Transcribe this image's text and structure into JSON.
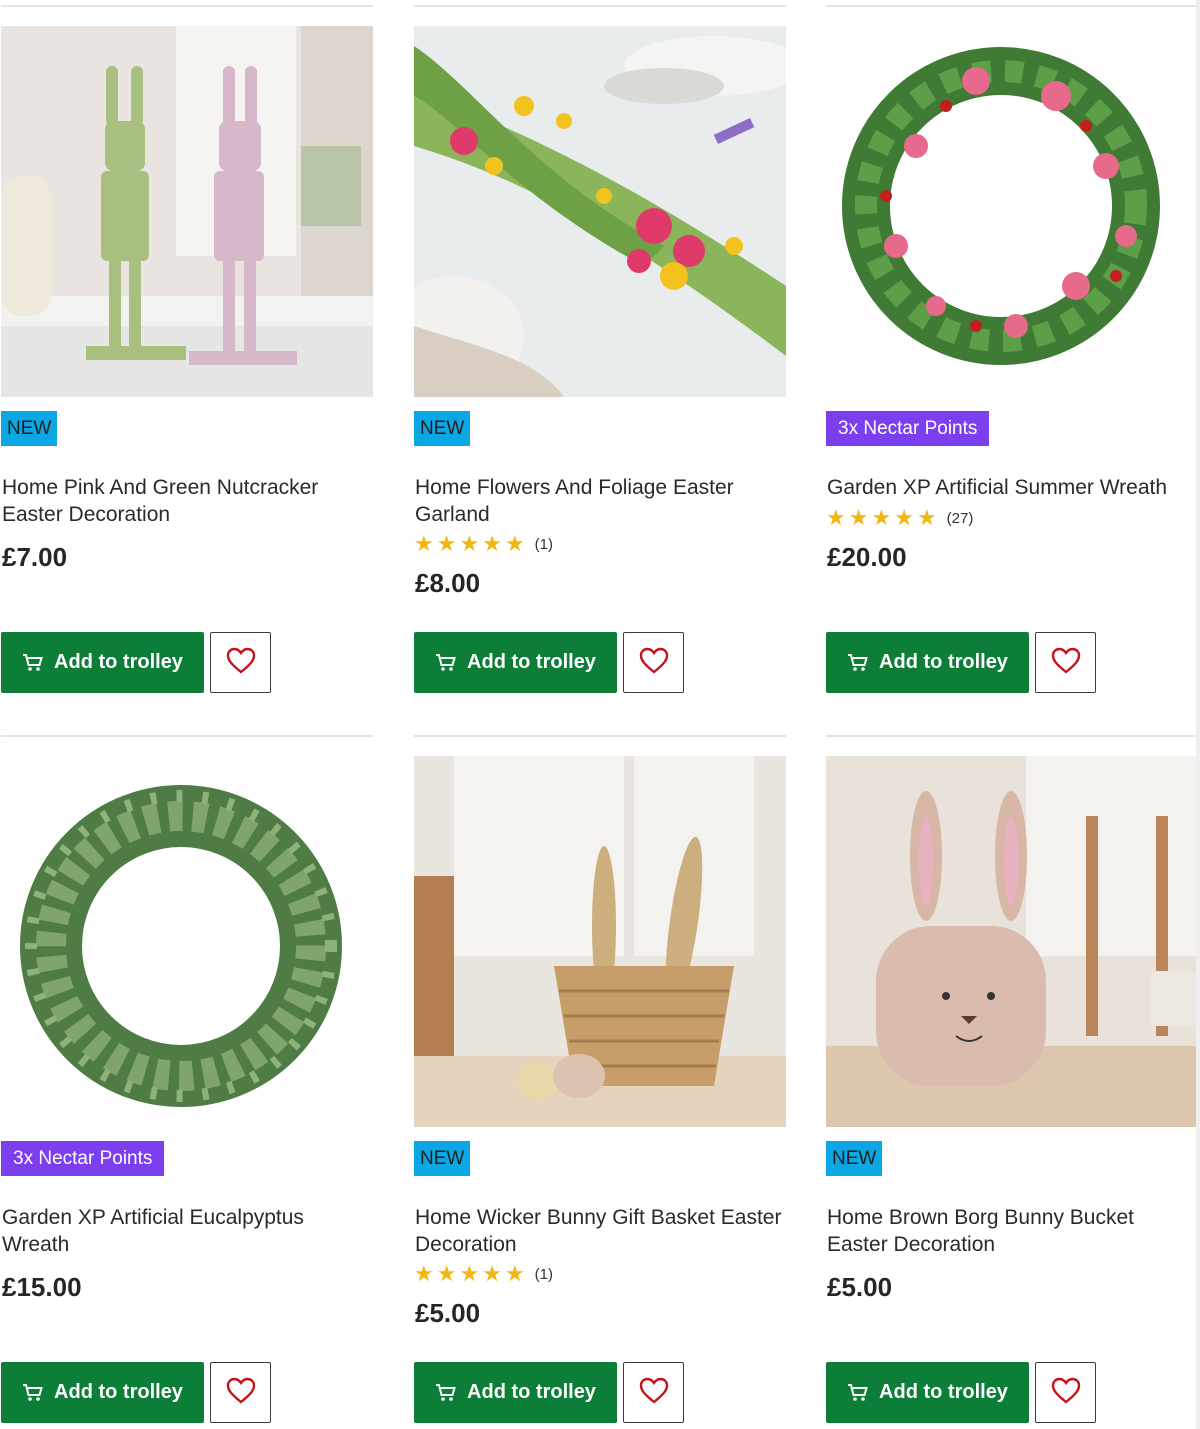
{
  "colors": {
    "brand_green": "#0c7e38",
    "new_badge": "#0aa7e4",
    "nectar_badge": "#7b3ff0",
    "star": "#f2b811",
    "heart": "#c4121a"
  },
  "actions": {
    "add_label": "Add to trolley",
    "cart_icon": "trolley-icon",
    "favourite_icon": "heart-icon"
  },
  "products": [
    {
      "badge": "NEW",
      "badge_type": "new",
      "title": "Home Pink And Green Nutcracker Easter Decoration",
      "price": "£7.00",
      "rating": null,
      "image": "nutcracker-figures"
    },
    {
      "badge": "NEW",
      "badge_type": "new",
      "title": "Home Flowers And Foliage Easter Garland",
      "price": "£8.00",
      "rating": {
        "stars": 5,
        "count": "(1)"
      },
      "image": "flower-garland"
    },
    {
      "badge": "3x Nectar Points",
      "badge_type": "nectar",
      "title": "Garden XP Artificial Summer Wreath",
      "price": "£20.00",
      "rating": {
        "stars": 5,
        "count": "(27)"
      },
      "image": "summer-wreath"
    },
    {
      "badge": "3x Nectar Points",
      "badge_type": "nectar",
      "title": "Garden XP Artificial Eucalpyptus Wreath",
      "price": "£15.00",
      "rating": null,
      "image": "eucalyptus-wreath"
    },
    {
      "badge": "NEW",
      "badge_type": "new",
      "title": "Home Wicker Bunny Gift Basket Easter Decoration",
      "price": "£5.00",
      "rating": {
        "stars": 5,
        "count": "(1)"
      },
      "image": "wicker-bunny-basket"
    },
    {
      "badge": "NEW",
      "badge_type": "new",
      "title": "Home Brown Borg Bunny Bucket Easter Decoration",
      "price": "£5.00",
      "rating": null,
      "image": "borg-bunny-bucket"
    }
  ]
}
